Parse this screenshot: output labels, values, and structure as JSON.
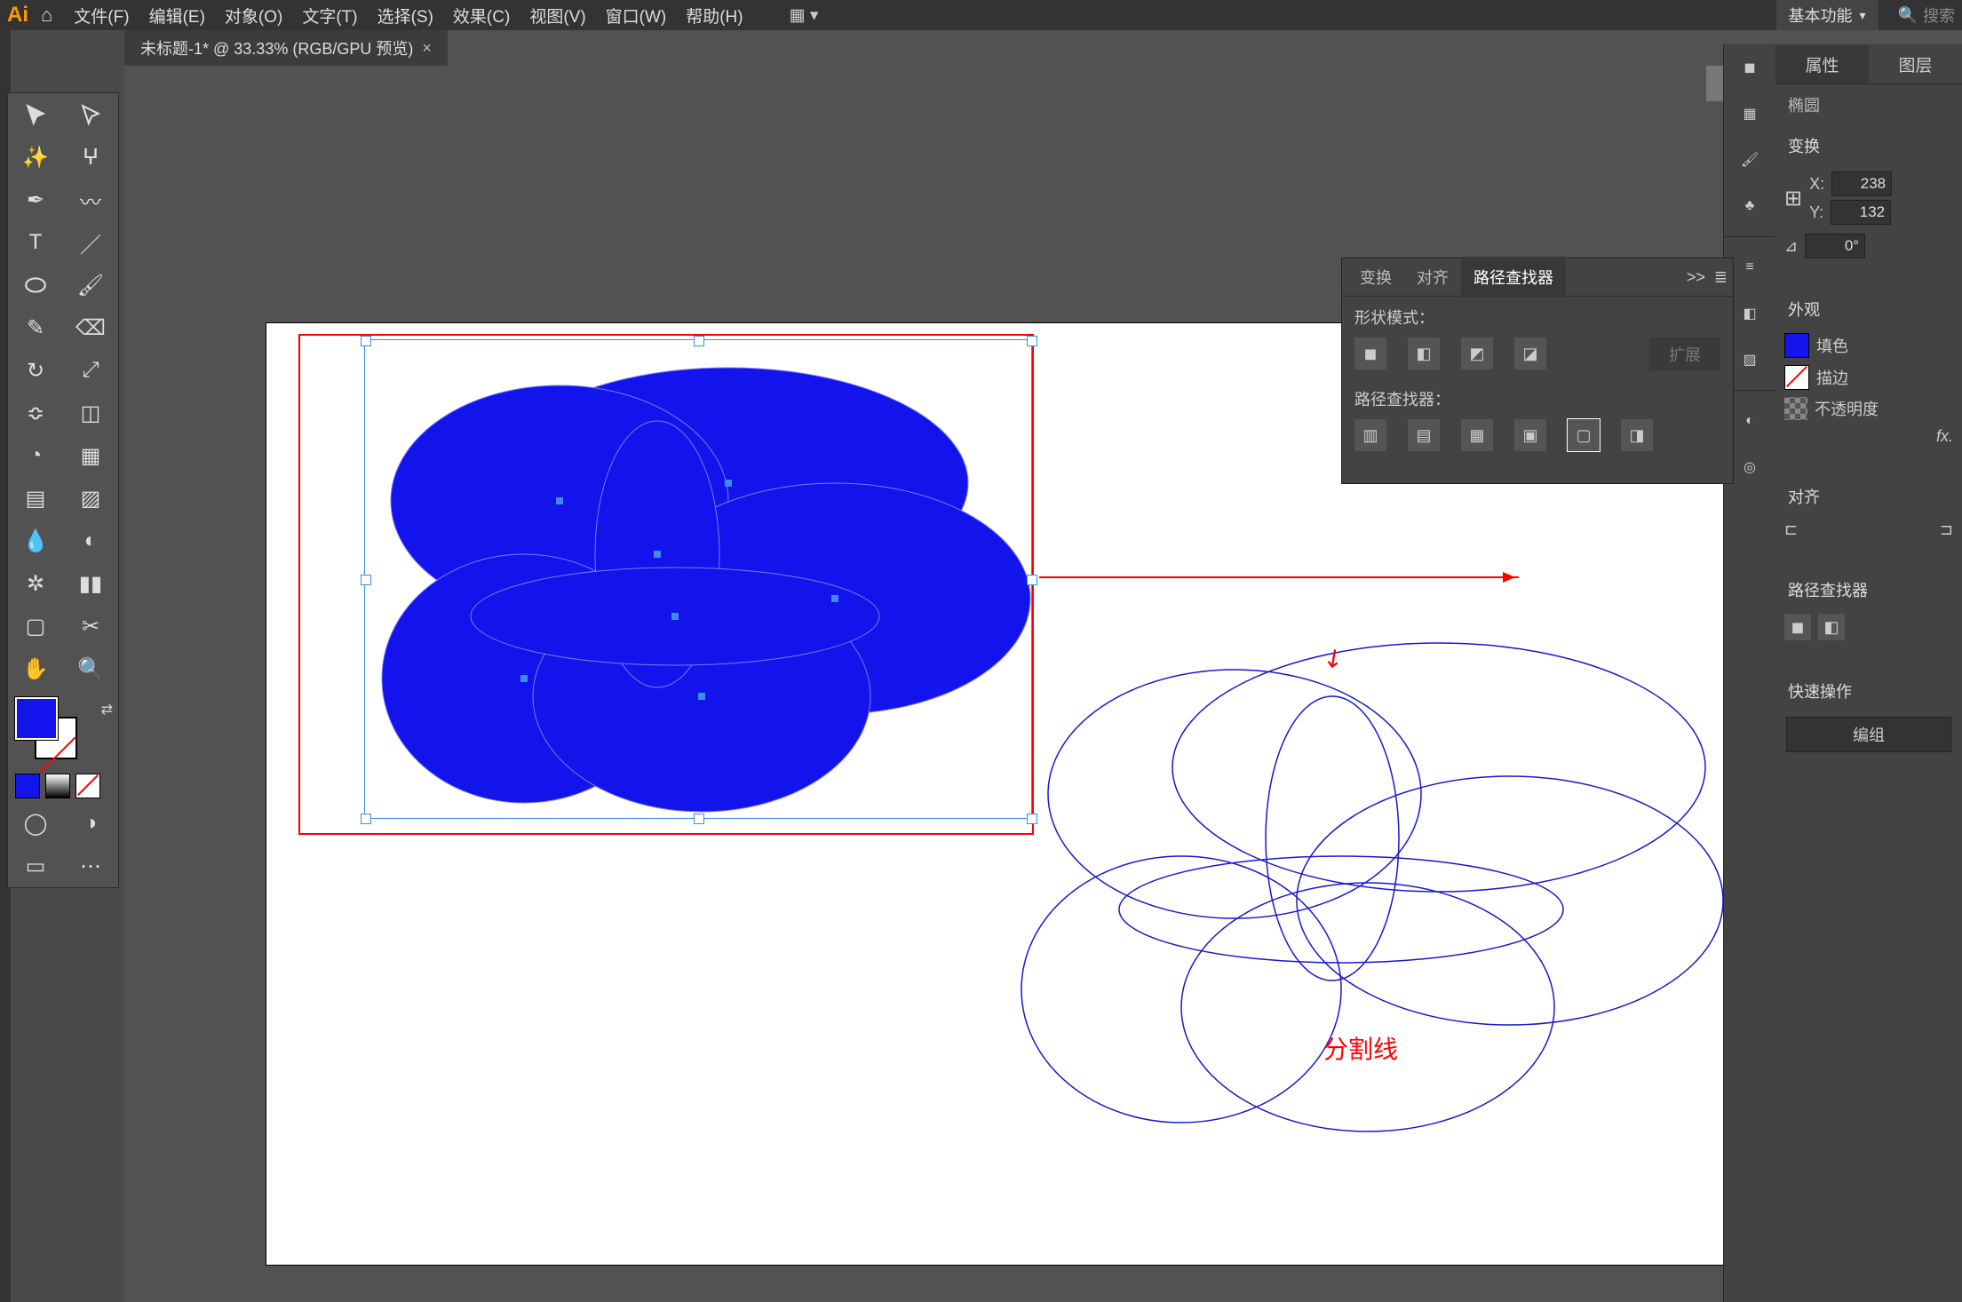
{
  "app": {
    "logo": "Ai"
  },
  "menu": {
    "file": "文件(F)",
    "edit": "编辑(E)",
    "object": "对象(O)",
    "type": "文字(T)",
    "select": "选择(S)",
    "effect": "效果(C)",
    "view": "视图(V)",
    "window": "窗口(W)",
    "help": "帮助(H)"
  },
  "workspace": {
    "label": "基本功能"
  },
  "search": {
    "placeholder": "搜索"
  },
  "tab": {
    "title": "未标题-1* @ 33.33% (RGB/GPU 预览)",
    "close": "×"
  },
  "swatch": {
    "fill": "#1313ec"
  },
  "pathfinder": {
    "tab_transform": "变换",
    "tab_align": "对齐",
    "tab_pathfinder": "路径查找器",
    "shape_modes_label": "形状模式：",
    "pathfinders_label": "路径查找器：",
    "expand": "扩展",
    "more": ">>",
    "menu": "≣"
  },
  "properties": {
    "tab_props": "属性",
    "tab_layers": "图层",
    "sel_label": "椭圆",
    "transform_label": "变换",
    "xlabel": "X:",
    "ylabel": "Y:",
    "x": "238",
    "y": "132",
    "angle_sym": "⊿",
    "angle": "0°",
    "appearance_label": "外观",
    "fill_label": "填色",
    "stroke_label": "描边",
    "opacity_label": "不透明度",
    "fx": "fx.",
    "align_label": "对齐",
    "pathfinder_label": "路径查找器",
    "quick_label": "快速操作",
    "group_btn": "编组"
  },
  "annot": {
    "divide": "分割线"
  }
}
